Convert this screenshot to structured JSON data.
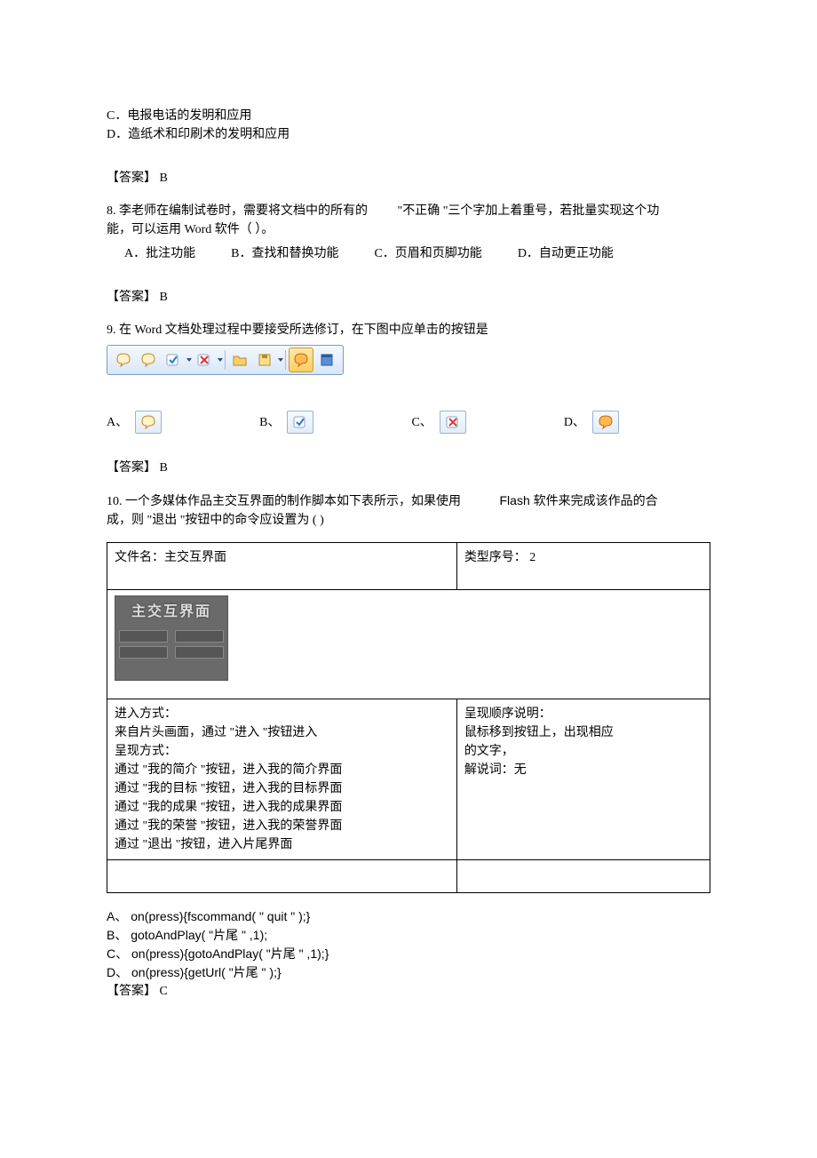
{
  "q7": {
    "optC": "C．电报电话的发明和应用",
    "optD": "D．造纸术和印刷术的发明和应用",
    "answer_label": "【答案】 B"
  },
  "q8": {
    "stem_a": "8. 李老师在编制试卷时，需要将文档中的所有的",
    "stem_b": "\"不正确 \"三个字加上着重号，若批量实现这个功",
    "stem_c": "能，可以运用   Word  软件（    ）。",
    "optA": "A．批注功能",
    "optB": "B．查找和替换功能",
    "optC": "C．页眉和页脚功能",
    "optD": "D．自动更正功能",
    "answer_label": "【答案】 B"
  },
  "q9": {
    "stem": "9. 在 Word  文档处理过程中要接受所选修订，在下图中应单击的按钮是",
    "optA": "A、",
    "optB": "B、",
    "optC": "C、",
    "optD": "D、",
    "answer_label": "【答案】 B"
  },
  "q10": {
    "stem_a": "10. 一个多媒体作品主交互界面的制作脚本如下表所示，如果使用",
    "stem_b": "Flash  软件来完成该作品的合",
    "stem_c": "成，则  \"退出 \"按钮中的命令应设置为     (     )",
    "table": {
      "r1c1": "文件名：主交互界面",
      "r1c2": "类型序号：   2",
      "thumb_title": "主交互界面",
      "r3c1_lines": [
        "进入方式：",
        "来自片头画面，通过    \"进入 \"按钮进入",
        "呈现方式：",
        "通过  \"我的简介  \"按钮，进入我的简介界面",
        "通过  \"我的目标  \"按钮，进入我的目标界面",
        "通过  \"我的成果  \"按钮，进入我的成果界面",
        "通过  \"我的荣誉  \"按钮，进入我的荣誉界面",
        "通过  \"退出 \"按钮，进入片尾界面"
      ],
      "r3c2_lines": [
        "呈现顺序说明：",
        "鼠标移到按钮上，出现相应",
        "的文字，",
        "解说词：无"
      ]
    },
    "optA": "A、 on(press){fscommand(      \" quit  \" );}",
    "optB": "B、 gotoAndPlay(    \"片尾  \" ,1);",
    "optC": "C、 on(press){gotoAndPlay(       \"片尾  \" ,1);}",
    "optD": "D、 on(press){getUrl(     \"片尾  \" );}",
    "answer_label": "【答案】 C"
  }
}
